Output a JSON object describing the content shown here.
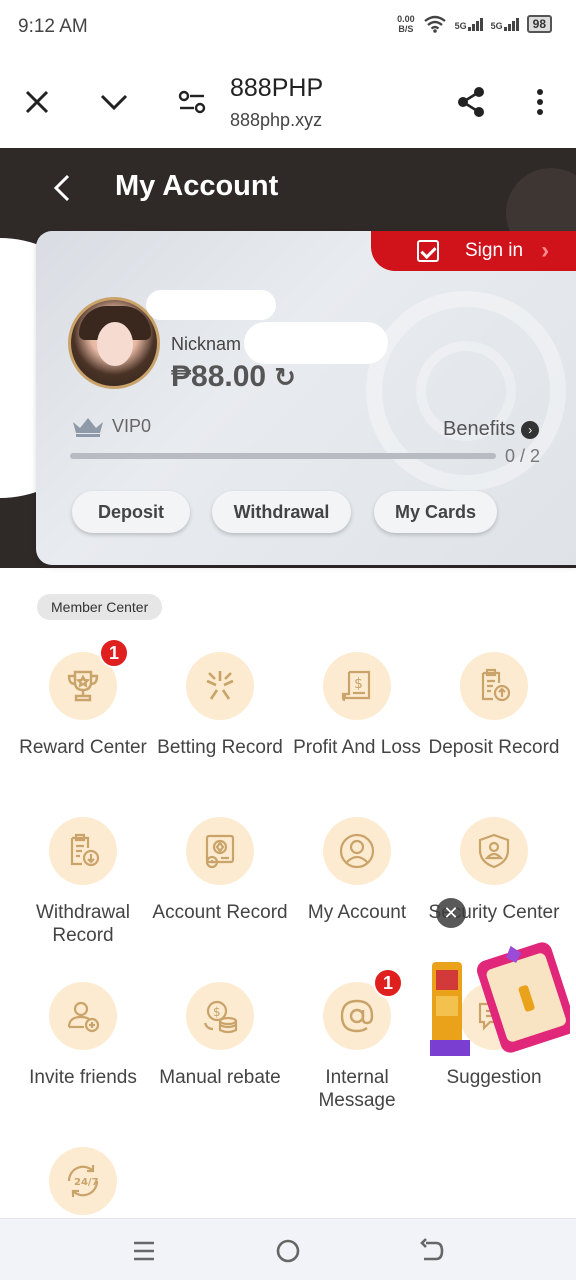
{
  "status_bar": {
    "time": "9:12 AM",
    "net_speed_value": "0.00",
    "net_speed_unit": "B/S",
    "signal1_label": "5G",
    "signal2_label": "5G",
    "battery": "98"
  },
  "browser": {
    "title": "888PHP",
    "url": "888php.xyz",
    "icons": [
      "close-icon",
      "chevron-down-icon",
      "site-settings-icon",
      "share-icon",
      "more-vertical-icon"
    ]
  },
  "header": {
    "title": "My Account"
  },
  "sign_in": {
    "label": "Sign in"
  },
  "account": {
    "nickname_label": "Nicknam",
    "balance": "₱88.00",
    "vip_level": "VIP0",
    "benefits_label": "Benefits",
    "progress_text": "0 / 2",
    "progress_fraction": 0
  },
  "card_buttons": {
    "deposit": "Deposit",
    "withdrawal": "Withdrawal",
    "my_cards": "My Cards"
  },
  "member_center": {
    "label": "Member Center",
    "items": [
      {
        "label": "Reward Center",
        "icon": "trophy-icon",
        "badge": "1"
      },
      {
        "label": "Betting Record",
        "icon": "star-burst-icon"
      },
      {
        "label": "Profit And Loss",
        "icon": "receipt-icon"
      },
      {
        "label": "Deposit Record",
        "icon": "clipboard-upload-icon"
      },
      {
        "label": "Withdrawal Record",
        "icon": "clipboard-download-icon"
      },
      {
        "label": "Account Record",
        "icon": "account-record-icon"
      },
      {
        "label": "My Account",
        "icon": "user-circle-icon"
      },
      {
        "label": "Security Center",
        "icon": "shield-user-icon"
      },
      {
        "label": "Invite friends",
        "icon": "invite-user-icon"
      },
      {
        "label": "Manual rebate",
        "icon": "coins-icon"
      },
      {
        "label": "Internal Message",
        "icon": "at-sign-icon",
        "badge": "1"
      },
      {
        "label": "Suggestion",
        "icon": "chat-icon"
      },
      {
        "label": "",
        "icon": "support-24-7-icon"
      }
    ]
  },
  "colors": {
    "header_bg": "#2f2a27",
    "sign_in_bg": "#d0121b",
    "icon_circle": "#fcebd0",
    "badge": "#e0201f"
  }
}
